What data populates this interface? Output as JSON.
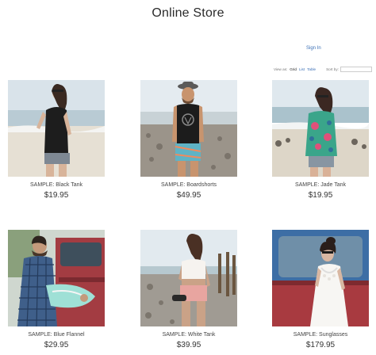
{
  "store": {
    "title": "Online Store"
  },
  "header": {
    "sign_in": "Sign In"
  },
  "toolbar": {
    "view_label": "View as:",
    "views": [
      "Grid",
      "List",
      "Table"
    ],
    "active_view": "Grid",
    "sort_label": "Sort by:"
  },
  "products": [
    {
      "name": "SAMPLE: Black Tank",
      "price": "$19.95"
    },
    {
      "name": "SAMPLE: Boardshorts",
      "price": "$49.95"
    },
    {
      "name": "SAMPLE: Jade Tank",
      "price": "$19.95"
    },
    {
      "name": "SAMPLE: Blue Flannel",
      "price": "$29.95"
    },
    {
      "name": "SAMPLE: White Tank",
      "price": "$39.95"
    },
    {
      "name": "SAMPLE: Sunglasses",
      "price": "$179.95"
    }
  ],
  "colors": {
    "link": "#3b6fb6",
    "text": "#333333"
  }
}
